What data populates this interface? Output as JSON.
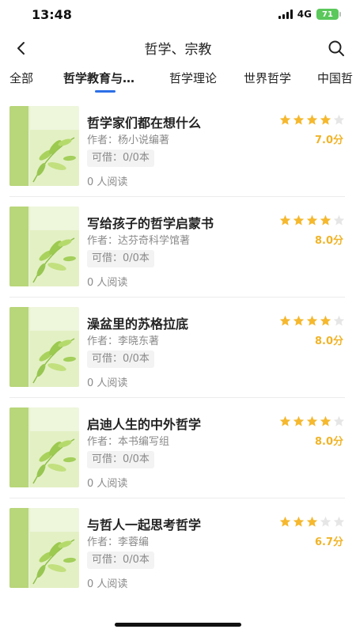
{
  "status": {
    "time": "13:48",
    "network": "4G",
    "battery": "71"
  },
  "nav": {
    "title": "哲学、宗教",
    "back_icon": "chevron-left-icon",
    "search_icon": "search-icon"
  },
  "tabs": [
    {
      "label": "全部"
    },
    {
      "label": "哲学教育与…",
      "active": true
    },
    {
      "label": "哲学理论"
    },
    {
      "label": "世界哲学"
    },
    {
      "label": "中国哲"
    }
  ],
  "colors": {
    "accent": "#2c6fe8",
    "star": "#f5b82e",
    "star_empty": "#e6e6e6",
    "score": "#f0b429"
  },
  "books": [
    {
      "title": "哲学家们都在想什么",
      "author": "作者：杨小说编著",
      "available": "可借：0/0本",
      "readers": "0 人阅读",
      "stars": 4,
      "score": "7.0分"
    },
    {
      "title": "写给孩子的哲学启蒙书",
      "author": "作者：达芬奇科学馆著",
      "available": "可借：0/0本",
      "readers": "0 人阅读",
      "stars": 4,
      "score": "8.0分"
    },
    {
      "title": "澡盆里的苏格拉底",
      "author": "作者：李晓东著",
      "available": "可借：0/0本",
      "readers": "0 人阅读",
      "stars": 4,
      "score": "8.0分"
    },
    {
      "title": "启迪人生的中外哲学",
      "author": "作者：本书编写组",
      "available": "可借：0/0本",
      "readers": "0 人阅读",
      "stars": 4,
      "score": "8.0分"
    },
    {
      "title": "与哲人一起思考哲学",
      "author": "作者：李蓉编",
      "available": "可借：0/0本",
      "readers": "0 人阅读",
      "stars": 3,
      "score": "6.7分"
    }
  ]
}
